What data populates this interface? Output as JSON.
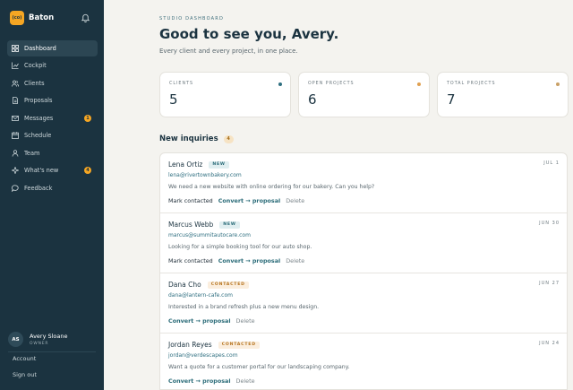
{
  "brand": {
    "name": "Baton",
    "logo_text": "(co)"
  },
  "nav": [
    {
      "label": "Dashboard",
      "icon": "grid-icon",
      "active": true
    },
    {
      "label": "Cockpit",
      "icon": "chart-icon"
    },
    {
      "label": "Clients",
      "icon": "users-icon"
    },
    {
      "label": "Proposals",
      "icon": "document-icon"
    },
    {
      "label": "Messages",
      "icon": "mail-icon",
      "badge": "1"
    },
    {
      "label": "Schedule",
      "icon": "calendar-icon"
    },
    {
      "label": "Team",
      "icon": "person-icon"
    },
    {
      "label": "What's new",
      "icon": "sparkle-icon",
      "badge": "4"
    },
    {
      "label": "Feedback",
      "icon": "chat-icon"
    }
  ],
  "user": {
    "initials": "AS",
    "name": "Avery Sloane",
    "role": "OWNER"
  },
  "footer_links": {
    "account": "Account",
    "signout": "Sign out"
  },
  "header": {
    "eyebrow": "STUDIO DASHBOARD",
    "title": "Good to see you, Avery.",
    "subtitle": "Every client and every project, in one place."
  },
  "stats": [
    {
      "label": "CLIENTS",
      "value": "5",
      "dot_color": "#2f6f80"
    },
    {
      "label": "OPEN PROJECTS",
      "value": "6",
      "dot_color": "#e0a050"
    },
    {
      "label": "TOTAL PROJECTS",
      "value": "7",
      "dot_color": "#c9a066"
    }
  ],
  "inquiries_section": {
    "title": "New inquiries",
    "count": "4"
  },
  "inquiries": [
    {
      "name": "Lena Ortiz",
      "tag": "NEW",
      "date": "JUL 1",
      "email": "lena@rivertownbakery.com",
      "message": "We need a new website with online ordering for our bakery. Can you help?",
      "mark": "Mark contacted",
      "convert": "Convert → proposal",
      "delete": "Delete"
    },
    {
      "name": "Marcus Webb",
      "tag": "NEW",
      "date": "JUN 30",
      "email": "marcus@summitautocare.com",
      "message": "Looking for a simple booking tool for our auto shop.",
      "mark": "Mark contacted",
      "convert": "Convert → proposal",
      "delete": "Delete"
    },
    {
      "name": "Dana Cho",
      "tag": "CONTACTED",
      "date": "JUN 27",
      "email": "dana@lantern-cafe.com",
      "message": "Interested in a brand refresh plus a new menu design.",
      "convert": "Convert → proposal",
      "delete": "Delete"
    },
    {
      "name": "Jordan Reyes",
      "tag": "CONTACTED",
      "date": "JUN 24",
      "email": "jordan@verdescapes.com",
      "message": "Want a quote for a customer portal for our landscaping company.",
      "convert": "Convert → proposal",
      "delete": "Delete"
    }
  ]
}
